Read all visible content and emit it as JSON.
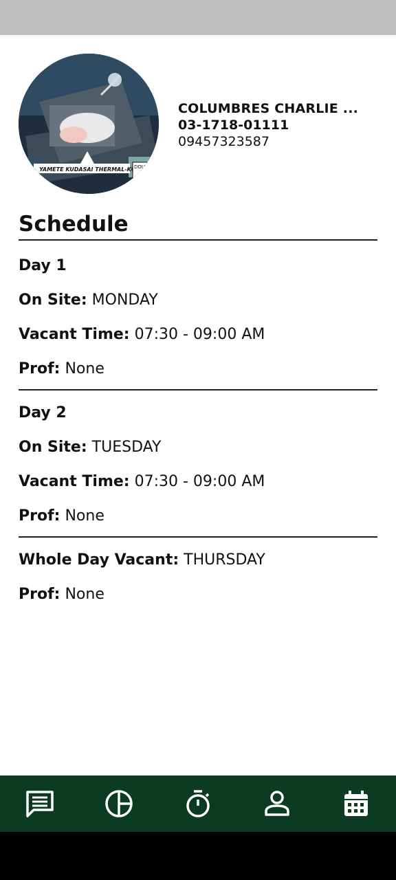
{
  "profile": {
    "name": "COLUMBRES CHARLIE ...",
    "id": "03-1718-01111",
    "phone": "09457323587",
    "avatar_caption": "YAMETE KUDASAI THERMAL-KUN",
    "avatar_caption_small": "DOU"
  },
  "schedule": {
    "title": "Schedule",
    "day1": {
      "title": "Day 1",
      "on_site_label": "On Site:",
      "on_site_value": "MONDAY",
      "vacant_label": "Vacant Time:",
      "vacant_value": "07:30 - 09:00 AM",
      "prof_label": "Prof:",
      "prof_value": "None"
    },
    "day2": {
      "title": "Day 2",
      "on_site_label": "On Site:",
      "on_site_value": "TUESDAY",
      "vacant_label": "Vacant Time:",
      "vacant_value": "07:30 - 09:00 AM",
      "prof_label": "Prof:",
      "prof_value": "None"
    },
    "whole_day": {
      "label": "Whole Day Vacant:",
      "value": "THURSDAY",
      "prof_label": "Prof:",
      "prof_value": "None"
    }
  },
  "nav": {
    "items": [
      {
        "icon": "message-icon"
      },
      {
        "icon": "pie-chart-icon"
      },
      {
        "icon": "timer-icon"
      },
      {
        "icon": "profile-icon"
      },
      {
        "icon": "calendar-icon"
      }
    ],
    "bar_color": "#0b3b22",
    "icon_color": "#ffffff"
  }
}
